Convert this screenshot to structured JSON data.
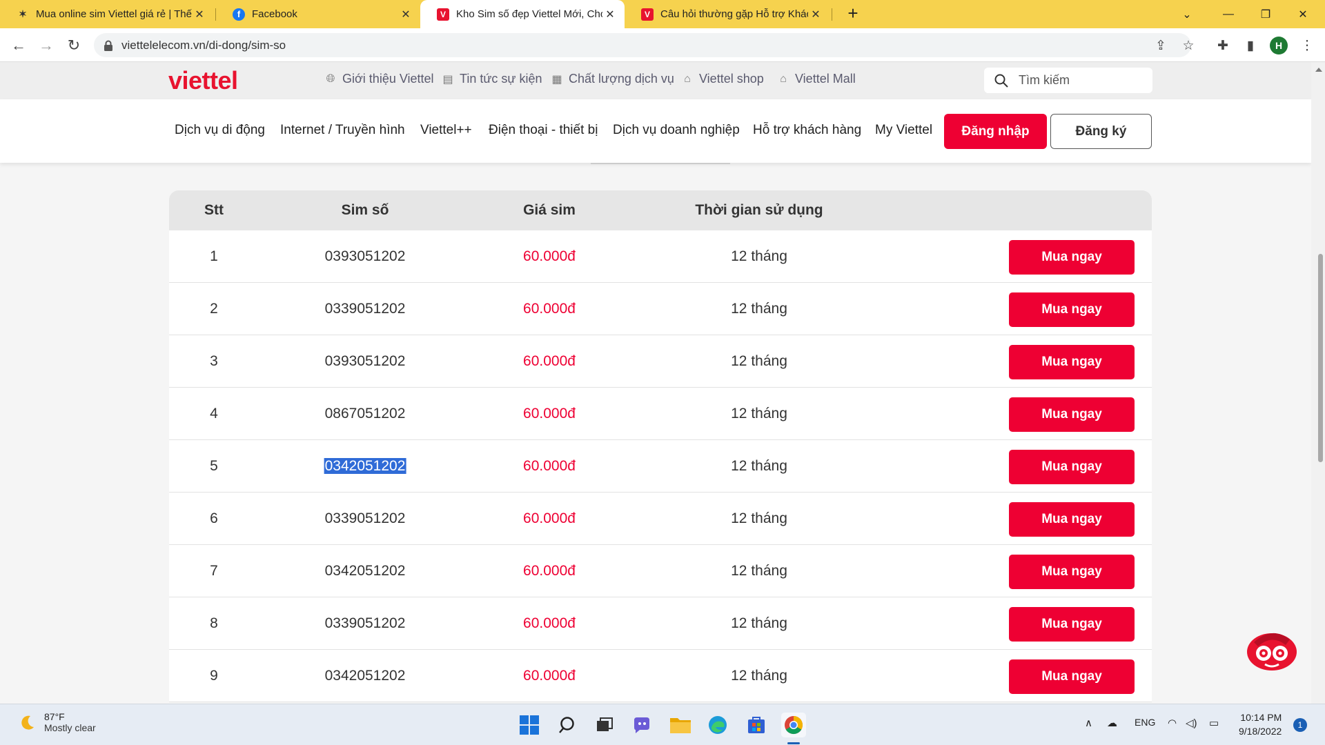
{
  "browser": {
    "tabs": [
      {
        "title": "Mua online sim Viettel giá rẻ | Thế",
        "active": false,
        "favicon": "viettel-promo-icon"
      },
      {
        "title": "Facebook",
        "active": false,
        "favicon": "facebook-icon"
      },
      {
        "title": "Kho Sim số đẹp Viettel Mới, Chọn",
        "active": true,
        "favicon": "viettel-icon"
      },
      {
        "title": "Câu hỏi thường gặp Hỗ trợ Khách",
        "active": false,
        "favicon": "viettel-icon"
      }
    ],
    "url": "viettelelecom.vn/di-dong/sim-so",
    "profile_initial": "H",
    "colors": {
      "tabbar": "#f6d24e"
    }
  },
  "site": {
    "logo": "viettel",
    "top_links": [
      {
        "label": "Giới thiệu Viettel",
        "icon": "globe-icon"
      },
      {
        "label": "Tin tức sự kiện",
        "icon": "news-icon"
      },
      {
        "label": "Chất lượng dịch vụ",
        "icon": "document-icon"
      },
      {
        "label": "Viettel shop",
        "icon": "shop-icon"
      },
      {
        "label": "Viettel Mall",
        "icon": "mall-icon"
      }
    ],
    "search_placeholder": "Tìm kiếm",
    "main_nav": [
      "Dịch vụ di động",
      "Internet / Truyền hình",
      "Viettel++",
      "Điện thoại - thiết bị",
      "Dịch vụ doanh nghiệp",
      "Hỗ trợ khách hàng",
      "My Viettel"
    ],
    "login_label": "Đăng nhập",
    "register_label": "Đăng ký",
    "colors": {
      "brand": "#ee0033"
    }
  },
  "table": {
    "headers": [
      "Stt",
      "Sim số",
      "Giá sim",
      "Thời gian sử dụng"
    ],
    "buy_label": "Mua ngay",
    "rows": [
      {
        "stt": "1",
        "sim": "0393051202",
        "price": "60.000đ",
        "duration": "12 tháng"
      },
      {
        "stt": "2",
        "sim": "0339051202",
        "price": "60.000đ",
        "duration": "12 tháng"
      },
      {
        "stt": "3",
        "sim": "0393051202",
        "price": "60.000đ",
        "duration": "12 tháng"
      },
      {
        "stt": "4",
        "sim": "0867051202",
        "price": "60.000đ",
        "duration": "12 tháng"
      },
      {
        "stt": "5",
        "sim": "0342051202",
        "price": "60.000đ",
        "duration": "12 tháng",
        "selected": true
      },
      {
        "stt": "6",
        "sim": "0339051202",
        "price": "60.000đ",
        "duration": "12 tháng"
      },
      {
        "stt": "7",
        "sim": "0342051202",
        "price": "60.000đ",
        "duration": "12 tháng"
      },
      {
        "stt": "8",
        "sim": "0339051202",
        "price": "60.000đ",
        "duration": "12 tháng"
      },
      {
        "stt": "9",
        "sim": "0342051202",
        "price": "60.000đ",
        "duration": "12 tháng"
      }
    ]
  },
  "taskbar": {
    "weather_temp": "87°F",
    "weather_desc": "Mostly clear",
    "language": "ENG",
    "time": "10:14 PM",
    "date": "9/18/2022",
    "notifications": "1"
  }
}
